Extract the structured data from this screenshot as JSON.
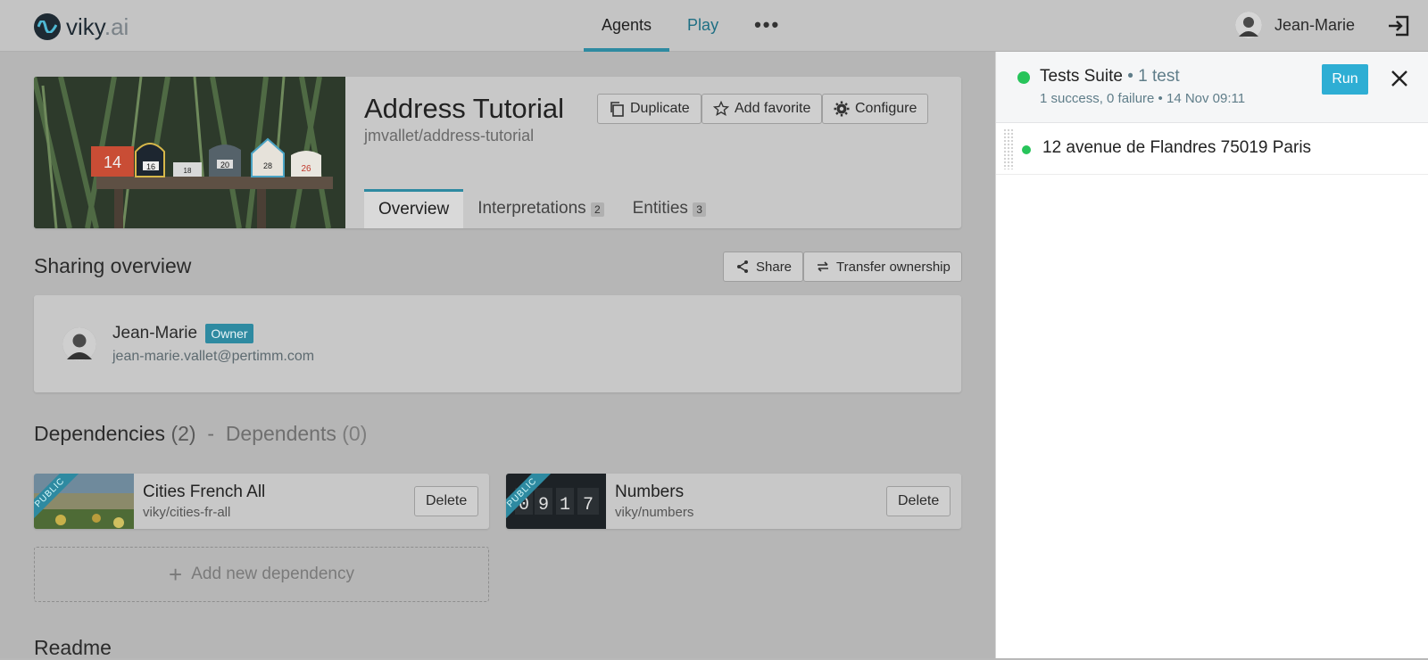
{
  "header": {
    "logo_text": "viky",
    "logo_suffix": ".ai",
    "nav": {
      "agents": "Agents",
      "play": "Play",
      "more": "•••"
    },
    "user_name": "Jean-Marie"
  },
  "agent": {
    "title": "Address Tutorial",
    "slug": "jmvallet/address-tutorial",
    "buttons": {
      "duplicate": "Duplicate",
      "favorite": "Add favorite",
      "configure": "Configure"
    },
    "tabs": {
      "overview": "Overview",
      "interpretations": "Interpretations",
      "interpretations_count": "2",
      "entities": "Entities",
      "entities_count": "3"
    },
    "image_numbers": [
      "14",
      "16",
      "18",
      "20",
      "28",
      "26"
    ]
  },
  "sharing": {
    "title": "Sharing overview",
    "share_label": "Share",
    "transfer_label": "Transfer ownership",
    "owner_name": "Jean-Marie",
    "owner_badge": "Owner",
    "owner_email": "jean-marie.vallet@pertimm.com"
  },
  "dependencies": {
    "title": "Dependencies",
    "dependencies_count": "(2)",
    "separator": " - ",
    "dependents_title": "Dependents",
    "dependents_count": "(0)",
    "items": [
      {
        "name": "Cities French All",
        "slug": "viky/cities-fr-all",
        "ribbon": "PUBLIC",
        "delete": "Delete"
      },
      {
        "name": "Numbers",
        "slug": "viky/numbers",
        "ribbon": "PUBLIC",
        "delete": "Delete"
      }
    ],
    "add_label": "Add new dependency"
  },
  "readme": {
    "title": "Readme"
  },
  "tests_panel": {
    "title": "Tests Suite",
    "count": "• 1 test",
    "summary": "1 success, 0 failure • 14 Nov 09:11",
    "run_label": "Run",
    "tests": [
      {
        "text": "12 avenue de Flandres 75019 Paris",
        "status": "success"
      }
    ]
  },
  "colors": {
    "accent": "#2e8aa1",
    "run_button": "#2eaed4",
    "success": "#27c45a"
  }
}
